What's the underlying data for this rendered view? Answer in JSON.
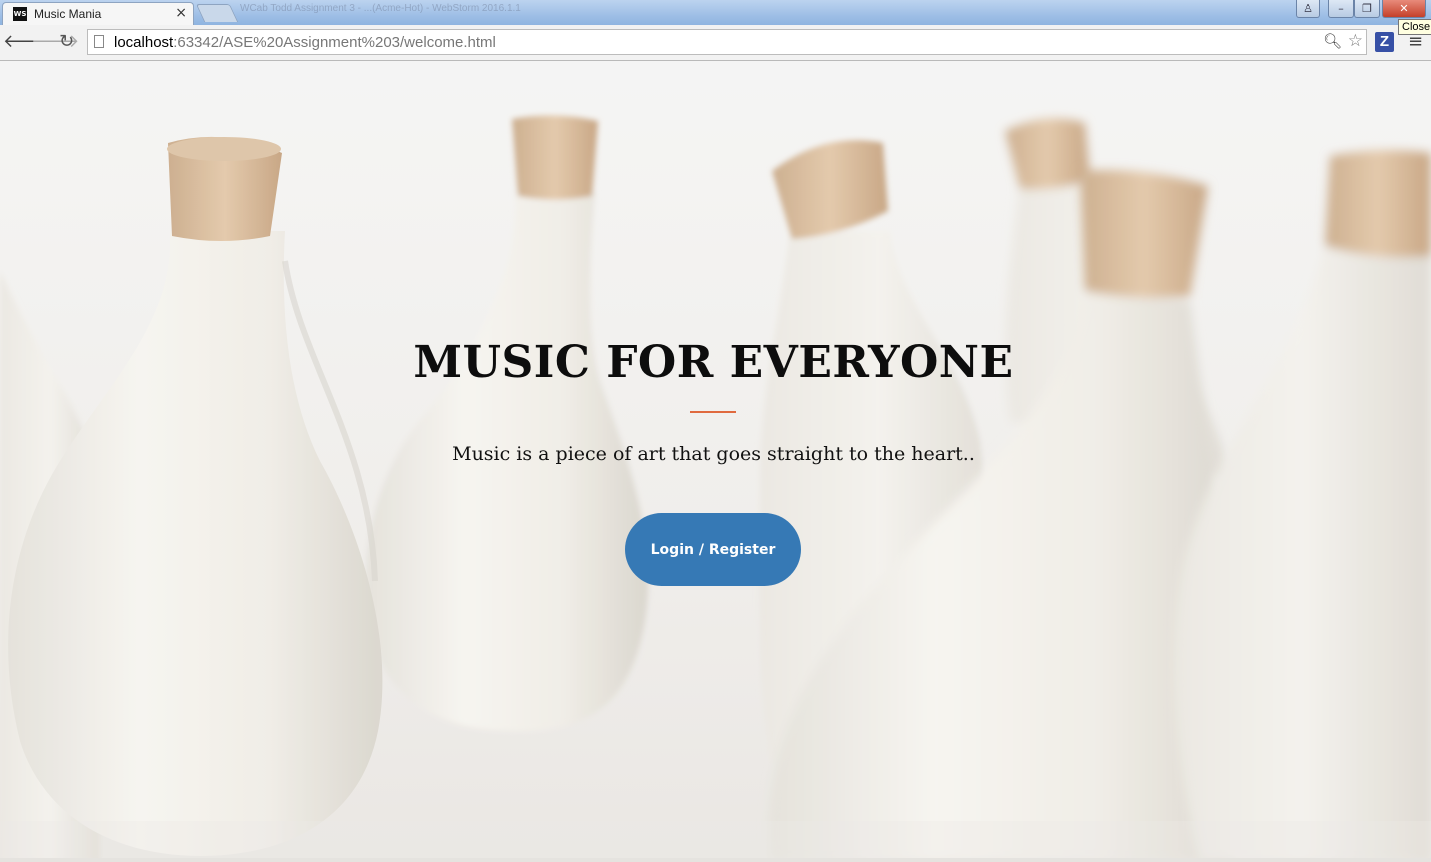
{
  "browser": {
    "tab": {
      "title": "Music Mania",
      "favicon_text": "WS"
    },
    "background_window_title": "WCab Todd Assignment 3 - ...(Acme-Hot) - WebStorm 2016.1.1",
    "close_tooltip": "Close",
    "address": {
      "host": "localhost",
      "path": ":63342/ASE%20Assignment%203/welcome.html"
    },
    "icons": {
      "back": "back-arrow-icon",
      "forward": "forward-arrow-icon",
      "reload": "reload-icon",
      "zoom": "zoom-icon",
      "bookmark": "star-icon",
      "extension": "z-extension-icon",
      "menu": "hamburger-menu-icon"
    },
    "extension_letter": "Z"
  },
  "hero": {
    "title": "MUSIC FOR EVERYONE",
    "subtitle": "Music is a piece of art that goes straight to the heart..",
    "button_label": "Login / Register",
    "colors": {
      "divider": "#e06a3f",
      "button": "#3679b5",
      "title": "#0d0d0d"
    },
    "background": "white ceramic bottles with cork stoppers"
  }
}
